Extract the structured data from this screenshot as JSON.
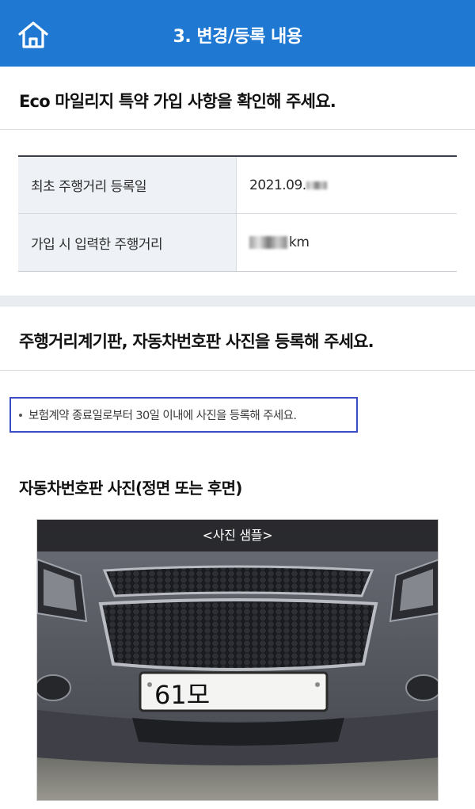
{
  "header": {
    "title": "3. 변경/등록 내용",
    "home_icon": "home-icon",
    "background": "#1f78d1"
  },
  "section1": {
    "title": "Eco 마일리지 특약 가입 사항을 확인해 주세요.",
    "rows": [
      {
        "label": "최초 주행거리 등록일",
        "value": "2021.09."
      },
      {
        "label": "가입 시 입력한 주행거리",
        "value": "km"
      }
    ]
  },
  "section2": {
    "title": "주행거리계기판, 자동차번호판 사진을 등록해 주세요.",
    "notice": "보험계약 종료일로부터 30일 이내에 사진을 등록해 주세요.",
    "notice_border_color": "#3b4dc4",
    "photo_heading": "자동차번호판 사진(정면 또는 후면)",
    "photo_label": "<사진 샘플>",
    "plate_text": "61모"
  }
}
